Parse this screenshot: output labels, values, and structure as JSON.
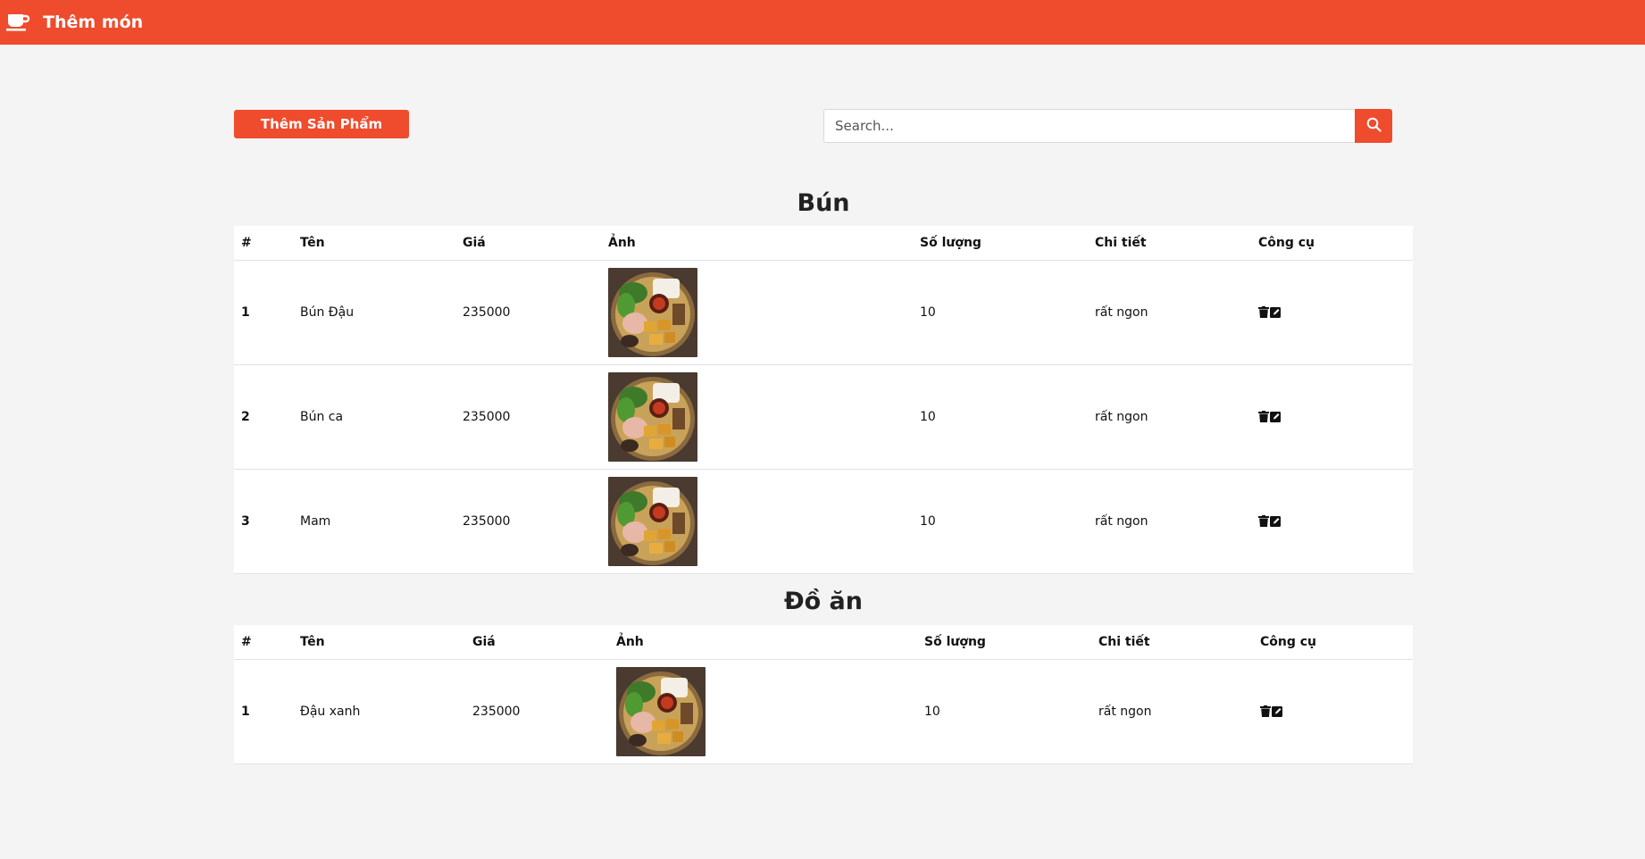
{
  "header": {
    "title": "Thêm món",
    "icon": "coffee-cup-icon",
    "bg_color": "#ef4b2d"
  },
  "toolbar": {
    "add_label": "Thêm Sản Phẩm"
  },
  "search": {
    "placeholder": "Search...",
    "icon": "search-icon"
  },
  "columns": [
    "#",
    "Tên",
    "Giá",
    "Ảnh",
    "Số lượng",
    "Chi tiết",
    "Công cụ"
  ],
  "sections": [
    {
      "title": "Bún",
      "rows": [
        {
          "idx": "1",
          "name": "Bún Đậu",
          "price": "235000",
          "qty": "10",
          "detail": "rất ngon"
        },
        {
          "idx": "2",
          "name": "Bún ca",
          "price": "235000",
          "qty": "10",
          "detail": "rất ngon"
        },
        {
          "idx": "3",
          "name": "Mam",
          "price": "235000",
          "qty": "10",
          "detail": "rất ngon"
        }
      ]
    },
    {
      "title": "Đồ ăn",
      "rows": [
        {
          "idx": "1",
          "name": "Đậu xanh",
          "price": "235000",
          "qty": "10",
          "detail": "rất ngon"
        }
      ]
    }
  ],
  "row_tools": [
    "trash-icon",
    "edit-icon"
  ]
}
